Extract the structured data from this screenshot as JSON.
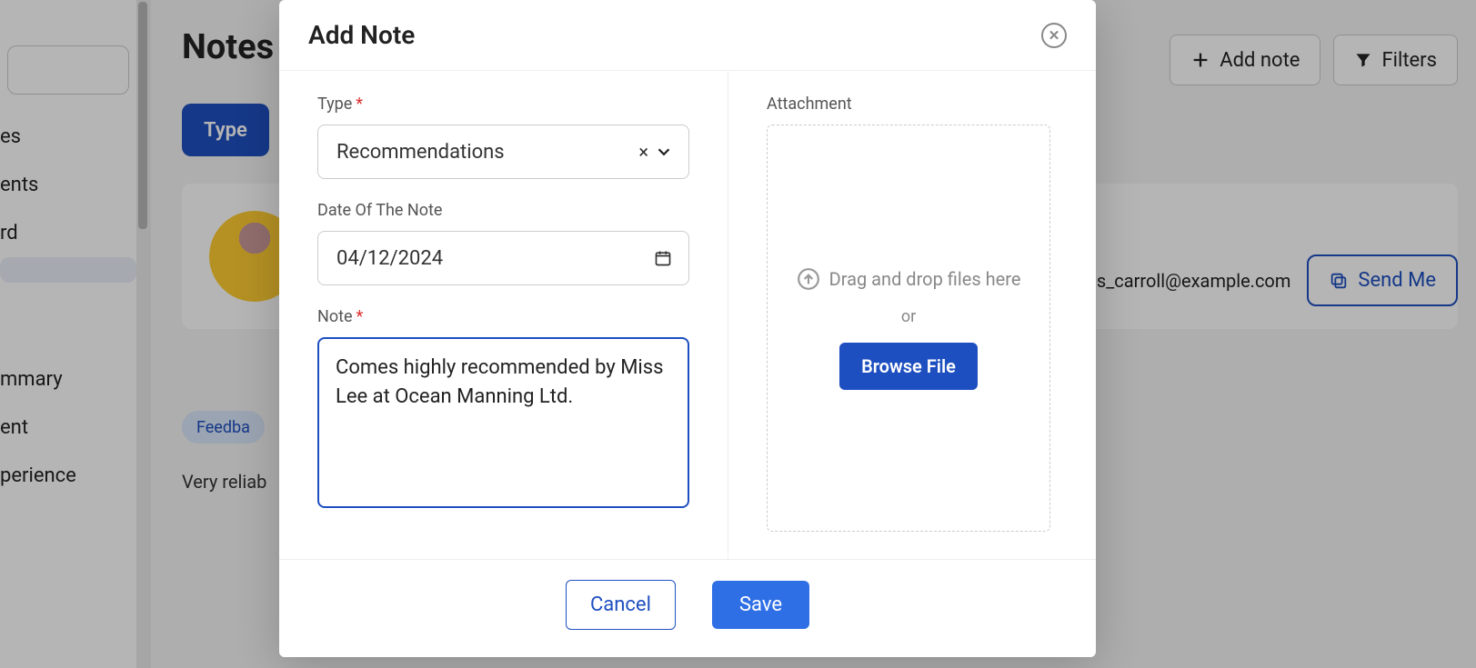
{
  "page": {
    "title": "Notes",
    "sidebar_items": [
      "es",
      "ents",
      "rd",
      "",
      "mmary",
      "ent",
      "perience"
    ],
    "add_note_label": "Add note",
    "filters_label": "Filters",
    "type_pill": "Type",
    "email": "lres_carroll@example.com",
    "send_message_label": "Send Me",
    "feedback_label": "Feedba",
    "existing_note": "Very reliab"
  },
  "modal": {
    "title": "Add Note",
    "type_label": "Type",
    "type_value": "Recommendations",
    "date_label": "Date Of The Note",
    "date_value": "04/12/2024",
    "note_label": "Note",
    "note_value": "Comes highly recommended by Miss Lee at Ocean Manning Ltd.",
    "attachment_label": "Attachment",
    "dropzone_text": "Drag and drop files here",
    "dropzone_or": "or",
    "browse_label": "Browse File",
    "cancel_label": "Cancel",
    "save_label": "Save"
  }
}
